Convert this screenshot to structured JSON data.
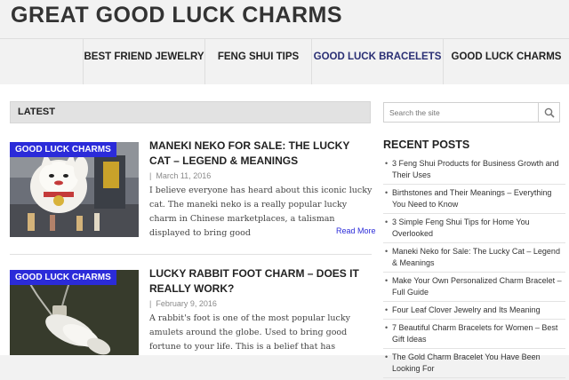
{
  "site": {
    "title": "GREAT GOOD LUCK CHARMS"
  },
  "nav": {
    "items": [
      {
        "label": "BEST FRIEND JEWELRY"
      },
      {
        "label": "FENG SHUI TIPS"
      },
      {
        "label": "GOOD LUCK BRACELETS"
      },
      {
        "label": "GOOD LUCK CHARMS"
      }
    ],
    "active_color": "#2a2f74"
  },
  "latest": {
    "heading": "LATEST"
  },
  "posts": [
    {
      "category": "GOOD LUCK CHARMS",
      "title": "MANEKI NEKO FOR SALE: THE LUCKY CAT – LEGEND & MEANINGS",
      "date": "March 11, 2016",
      "excerpt": "I believe everyone has heard about this iconic lucky cat. The maneki neko is a really popular lucky charm in Chinese marketplaces, a talisman displayed to bring good",
      "read_more": "Read More",
      "image_icon": "lucky-cat-photo"
    },
    {
      "category": "GOOD LUCK CHARMS",
      "title": "LUCKY RABBIT FOOT CHARM – DOES IT REALLY WORK?",
      "date": "February 9, 2016",
      "excerpt": "A rabbit's foot is one of the most popular lucky amulets around the globe. Used to bring good fortune to your life. This is a belief that has",
      "image_icon": "rabbit-foot-photo"
    }
  ],
  "sidebar": {
    "search_placeholder": "Search the site",
    "recent_heading": "RECENT POSTS",
    "recent_posts": [
      {
        "label": "3 Feng Shui Products for Business Growth and Their Uses"
      },
      {
        "label": "Birthstones and Their Meanings – Everything You Need to Know"
      },
      {
        "label": "3 Simple Feng Shui Tips for Home You Overlooked"
      },
      {
        "label": "Maneki Neko for Sale: The Lucky Cat – Legend & Meanings"
      },
      {
        "label": "Make Your Own Personalized Charm Bracelet – Full Guide"
      },
      {
        "label": "Four Leaf Clover Jewelry and Its Meaning"
      },
      {
        "label": "7 Beautiful Charm Bracelets for Women – Best Gift Ideas"
      },
      {
        "label": "The Gold Charm Bracelet You Have Been Looking For"
      }
    ]
  },
  "colors": {
    "accent": "#2b2bd9",
    "background": "#f2f2f2"
  }
}
